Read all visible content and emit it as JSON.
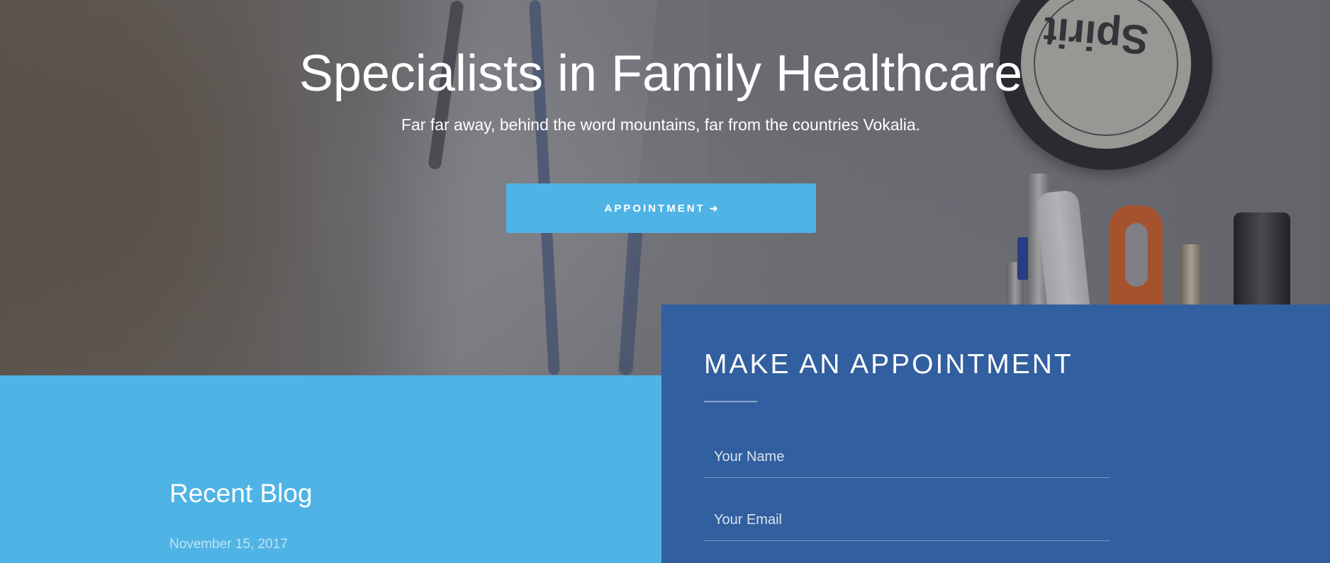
{
  "hero": {
    "title": "Specialists in Family Healthcare",
    "subtitle": "Far far away, behind the word mountains, far from the countries Vokalia.",
    "button_label": "APPOINTMENT",
    "button_icon": "arrow-right-icon",
    "badge_text": "Spirit"
  },
  "blog": {
    "heading": "Recent Blog",
    "date": "November 15, 2017"
  },
  "appointment_form": {
    "heading": "MAKE AN APPOINTMENT",
    "name_placeholder": "Your Name",
    "email_placeholder": "Your Email"
  },
  "colors": {
    "accent_light_blue": "#50b3e5",
    "form_panel_blue": "#315f9f",
    "text_white": "#ffffff"
  }
}
